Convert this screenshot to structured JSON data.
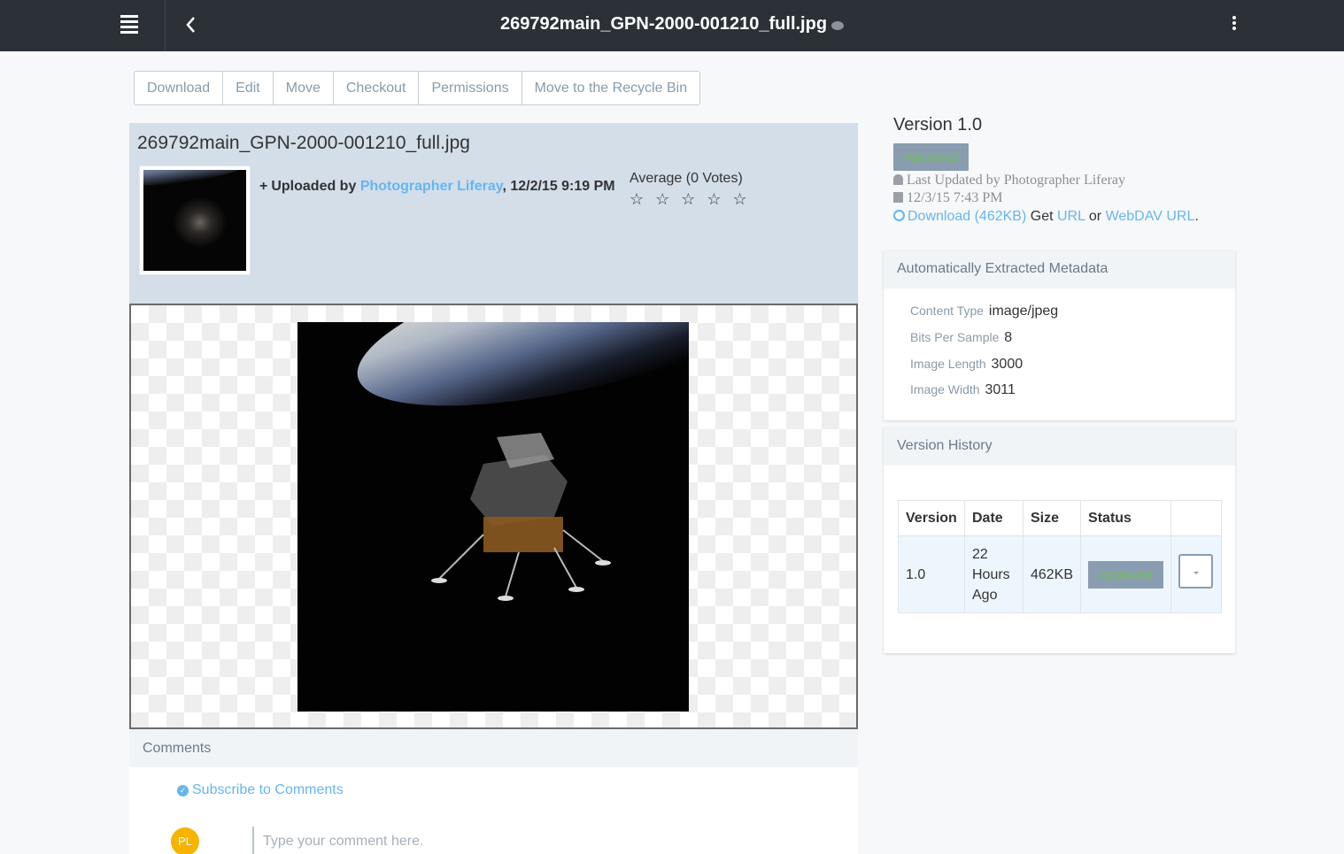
{
  "header": {
    "title": "269792main_GPN-2000-001210_full.jpg",
    "icons": {
      "menu": "hamburger-icon",
      "back": "chevron-left-icon",
      "info": "info-icon",
      "options": "kebab-icon"
    }
  },
  "toolbar": {
    "download": "Download",
    "edit": "Edit",
    "move": "Move",
    "checkout": "Checkout",
    "permissions": "Permissions",
    "recycle": "Move to the Recycle Bin"
  },
  "document": {
    "title": "269792main_GPN-2000-001210_full.jpg",
    "uploaded_prefix": "Uploaded by",
    "uploader": "Photographer Liferay",
    "uploaded_date": ", 12/2/15 9:19 PM",
    "rating_label": "Average (0 Votes)",
    "rating_stars": "☆ ☆ ☆ ☆ ☆",
    "rating_value": 0,
    "rating_max": 5
  },
  "comments": {
    "header": "Comments",
    "subscribe": "Subscribe to Comments",
    "avatar_initials": "PL",
    "placeholder": "Type your comment here."
  },
  "version": {
    "title": "Version 1.0",
    "status": "Approved",
    "last_updated": "Last Updated by Photographer Liferay",
    "date": "12/3/15 7:43 PM",
    "download_label": "Download (462KB)",
    "get_text": "Get",
    "url_label": "URL",
    "or_text": "or",
    "webdav_label": "WebDAV URL",
    "period": "."
  },
  "metadata": {
    "header": "Automatically Extracted Metadata",
    "rows": [
      {
        "label": "Content Type",
        "value": "image/jpeg"
      },
      {
        "label": "Bits Per Sample",
        "value": "8"
      },
      {
        "label": "Image Length",
        "value": "3000"
      },
      {
        "label": "Image Width",
        "value": "3011"
      }
    ]
  },
  "version_history": {
    "header": "Version History",
    "columns": [
      "Version",
      "Date",
      "Size",
      "Status"
    ],
    "rows": [
      {
        "version": "1.0",
        "date": "22 Hours Ago",
        "size": "462KB",
        "status": "Approved"
      }
    ]
  },
  "colors": {
    "topbar": "#2b3137",
    "link": "#65b6f0",
    "approved_badge_bg": "#8a9db0",
    "approved_text": "#6fbf55",
    "avatar": "#f5b400"
  }
}
